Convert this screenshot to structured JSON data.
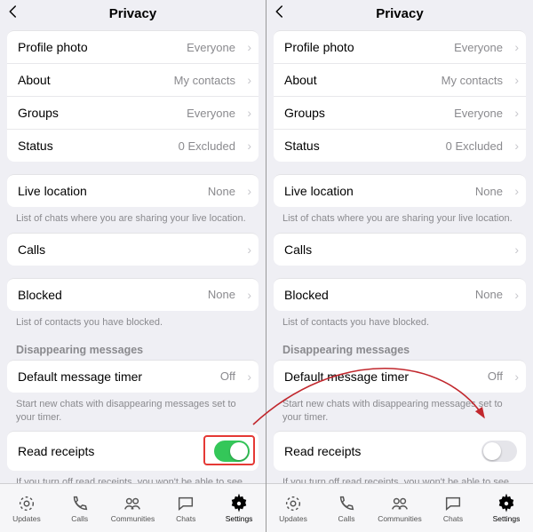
{
  "header": {
    "title": "Privacy"
  },
  "rows": {
    "profile_photo": {
      "label": "Profile photo",
      "value": "Everyone"
    },
    "about": {
      "label": "About",
      "value": "My contacts"
    },
    "groups": {
      "label": "Groups",
      "value": "Everyone"
    },
    "status": {
      "label": "Status",
      "value": "0 Excluded"
    },
    "live_location": {
      "label": "Live location",
      "value": "None"
    },
    "calls": {
      "label": "Calls",
      "value": ""
    },
    "blocked": {
      "label": "Blocked",
      "value": "None"
    },
    "default_timer": {
      "label": "Default message timer",
      "value": "Off"
    },
    "read_receipts": {
      "label": "Read receipts"
    }
  },
  "footers": {
    "live_location": "List of chats where you are sharing your live location.",
    "blocked": "List of contacts you have blocked.",
    "timer": "Start new chats with disappearing messages set to your timer.",
    "read_receipts": "If you turn off read receipts, you won't be able to see read receipts from other people. Read receipts are always sent for group chats."
  },
  "sections": {
    "disappearing": "Disappearing messages"
  },
  "tabs": {
    "updates": "Updates",
    "calls": "Calls",
    "communities": "Communities",
    "chats": "Chats",
    "settings": "Settings"
  },
  "left_toggle_on": true,
  "right_toggle_on": false,
  "colors": {
    "toggle_on": "#34C759",
    "highlight": "#E53935",
    "arrow": "#C1272D"
  }
}
